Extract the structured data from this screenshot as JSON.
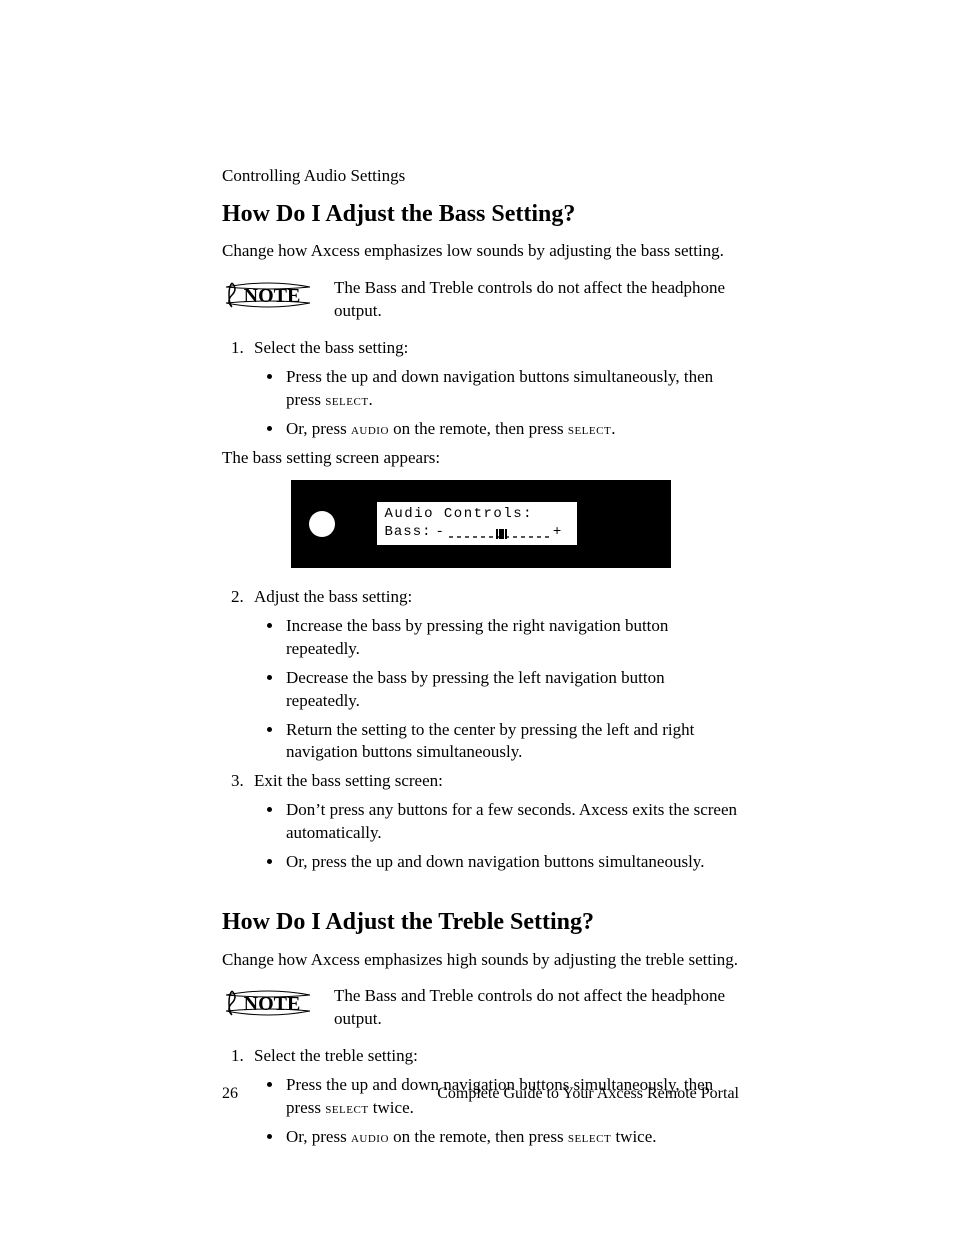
{
  "header": {
    "section": "Controlling Audio Settings"
  },
  "bass": {
    "title": "How Do I Adjust the Bass Setting?",
    "intro": "Change how Axcess emphasizes low sounds by adjusting the bass setting.",
    "note": "The Bass and Treble controls do not affect the headphone output.",
    "step1": {
      "text": "Select the bass setting:",
      "b1_pre": "Press the up and down navigation buttons simultaneously, then press ",
      "b1_sc": "select",
      "b1_post": ".",
      "b2_pre": "Or, press ",
      "b2_sc1": "audio",
      "b2_mid": " on the remote, then press ",
      "b2_sc2": "select",
      "b2_post": "."
    },
    "after1": "The bass setting screen appears:",
    "lcd": {
      "line1": "Audio Controls:",
      "label": "Bass:",
      "minus": "-",
      "plus": "+"
    },
    "step2": {
      "text": "Adjust the bass setting:",
      "b1": "Increase the bass by pressing the right navigation button repeatedly.",
      "b2": "Decrease the bass by pressing the left navigation button repeatedly.",
      "b3": "Return the setting to the center by pressing the left and right navigation buttons simultaneously."
    },
    "step3": {
      "text": "Exit the bass setting screen:",
      "b1": "Don’t press any buttons for a few seconds. Axcess exits the screen automatically.",
      "b2": "Or, press the up and down navigation buttons simultaneously."
    }
  },
  "treble": {
    "title": "How Do I Adjust the Treble Setting?",
    "intro": "Change how Axcess emphasizes high sounds by adjusting the treble setting.",
    "note": "The Bass and Treble controls do not affect the headphone output.",
    "step1": {
      "text": "Select the treble setting:",
      "b1_pre": "Press the up and down navigation buttons simultaneously, then press ",
      "b1_sc": "select",
      "b1_post": " twice.",
      "b2_pre": "Or, press ",
      "b2_sc1": "audio",
      "b2_mid": " on the remote, then press ",
      "b2_sc2": "select",
      "b2_post": " twice."
    }
  },
  "footer": {
    "page": "26",
    "book": "Complete Guide to Your Axcess Remote Portal"
  },
  "note_label": "Note"
}
